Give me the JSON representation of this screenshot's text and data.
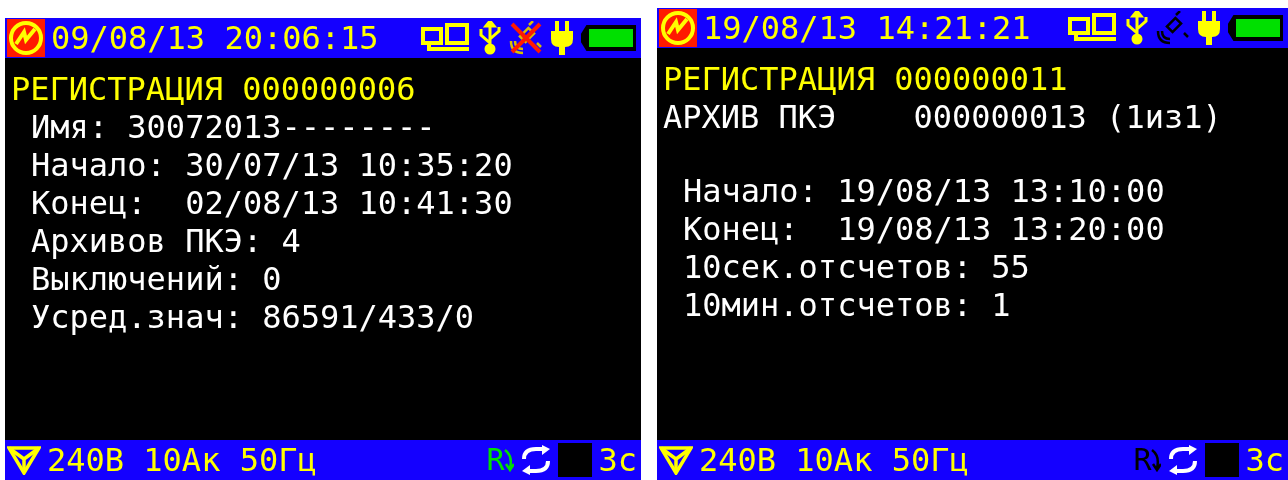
{
  "screens": [
    {
      "header": {
        "datetime": "09/08/13 20:06:15",
        "wireless_off": true
      },
      "heading_lines": [
        {
          "kind": "title",
          "text": "РЕГИСТРАЦИЯ 000000006"
        }
      ],
      "fields": [
        "Имя: 30072013--------",
        "Начало: 30/07/13 10:35:20",
        "Конец:  02/08/13 10:41:30",
        "Архивов ПКЭ: 4",
        "Выключений: 0",
        "Усред.знач: 86591/433/0"
      ],
      "footer": {
        "readings": "240В 10Ак 50Гц",
        "record_glyph": "R",
        "recording": true,
        "interval": "3с"
      }
    },
    {
      "header": {
        "datetime": "19/08/13 14:21:21",
        "wireless_off": false
      },
      "heading_lines": [
        {
          "kind": "title",
          "text": "РЕГИСТРАЦИЯ 000000011"
        },
        {
          "kind": "plain",
          "text": "АРХИВ ПКЭ    000000013 (1из1)"
        }
      ],
      "fields": [
        "Начало: 19/08/13 13:10:00",
        "Конец:  19/08/13 13:20:00",
        "10сек.отсчетов: 55",
        "10мин.отсчетов: 1"
      ],
      "footer": {
        "readings": "240В 10Ак 50Гц",
        "record_glyph": "R",
        "recording": false,
        "interval": "3с"
      }
    }
  ]
}
